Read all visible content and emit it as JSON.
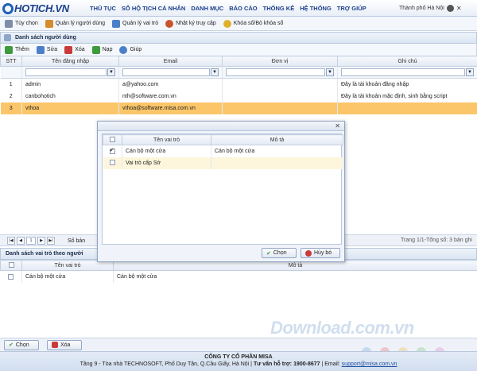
{
  "header": {
    "logo_text": "HOTICH.VN",
    "menu": [
      "THỦ TỤC",
      "SỔ HỘ TỊCH CÁ NHÂN",
      "DANH MỤC",
      "BÁO CÁO",
      "THỐNG KÊ",
      "HỆ THỐNG",
      "TRỢ GIÚP"
    ],
    "user": "Thành phố Hà Nội",
    "close_label": "✕"
  },
  "toolbar": {
    "items": [
      {
        "label": "Tùy chọn",
        "icon": "gear-icon",
        "color": "#7d8ea8"
      },
      {
        "label": "Quản lý người dùng",
        "icon": "users-icon",
        "color": "#d98a2b"
      },
      {
        "label": "Quản lý vai trò",
        "icon": "role-icon",
        "color": "#4b7fc9"
      },
      {
        "label": "Nhật ký truy cập",
        "icon": "log-icon",
        "color": "#c9552b"
      },
      {
        "label": "Khóa sổ/Bỏ khóa sổ",
        "icon": "lock-icon",
        "color": "#e0b02b"
      }
    ]
  },
  "users_panel": {
    "title": "Danh sách người dùng",
    "actions": [
      {
        "label": "Thêm",
        "icon": "add-icon",
        "color": "#3d9a3d"
      },
      {
        "label": "Sửa",
        "icon": "edit-icon",
        "color": "#4b7fc9"
      },
      {
        "label": "Xóa",
        "icon": "delete-icon",
        "color": "#c93b3b"
      },
      {
        "label": "Nạp",
        "icon": "reload-icon",
        "color": "#3d9a3d"
      },
      {
        "label": "Giúp",
        "icon": "help-icon",
        "color": "#4b7fc9"
      }
    ],
    "columns": [
      "STT",
      "Tên đăng nhập",
      "Email",
      "Đơn vị",
      "Ghi chú"
    ],
    "filter_button": "▼",
    "rows": [
      {
        "stt": "1",
        "username": "admin",
        "email": "a@yahoo.com",
        "unit": "",
        "note": "Đây là tài khoản đăng nhập"
      },
      {
        "stt": "2",
        "username": "canbohotich",
        "email": "nth@software.com.vn",
        "unit": "",
        "note": "Đây là tài khoản mặc định, sinh bằng script"
      },
      {
        "stt": "3",
        "username": "vthoa",
        "email": "vthoa@software.misa.com.vn",
        "unit": "",
        "note": ""
      }
    ],
    "selected_index": 2
  },
  "pager": {
    "page": "1",
    "left_text": "Số bản",
    "right_text": "Trang 1/1-Tổng số: 3 bản ghi",
    "first": "|◀",
    "prev": "◀",
    "next": "▶",
    "last": "▶|"
  },
  "dialog": {
    "close_label": "✕",
    "columns": [
      "Tên vai trò",
      "Mô tả"
    ],
    "rows": [
      {
        "checked": true,
        "name": "Cán bộ một cửa",
        "desc": "Cán bộ một cửa"
      },
      {
        "checked": false,
        "name": "Vai trò cấp Sở",
        "desc": ""
      }
    ],
    "ok_label": "Chọn",
    "cancel_label": "Hủy bỏ"
  },
  "roles_panel": {
    "title": "Danh sách vai trò theo người",
    "columns": [
      "Tên vai trò",
      "Mô tả"
    ],
    "rows": [
      {
        "name": "Cán bộ một cửa",
        "desc": "Cán bộ một cửa"
      }
    ]
  },
  "bottom_buttons": {
    "ok_label": "Chọn",
    "delete_label": "Xóa"
  },
  "footer": {
    "company": "CÔNG TY CỔ PHẦN MISA",
    "address": "Tầng 9 - Tòa nhà TECHNOSOFT, Phố Duy Tân, Q.Cầu Giấy, Hà Nội |",
    "hotline_label": "Tư vấn hỗ trợ: 1900-8677",
    "email_label": "| Email:",
    "email": "support@misa.com.vn"
  },
  "watermark": "Download.com.vn"
}
